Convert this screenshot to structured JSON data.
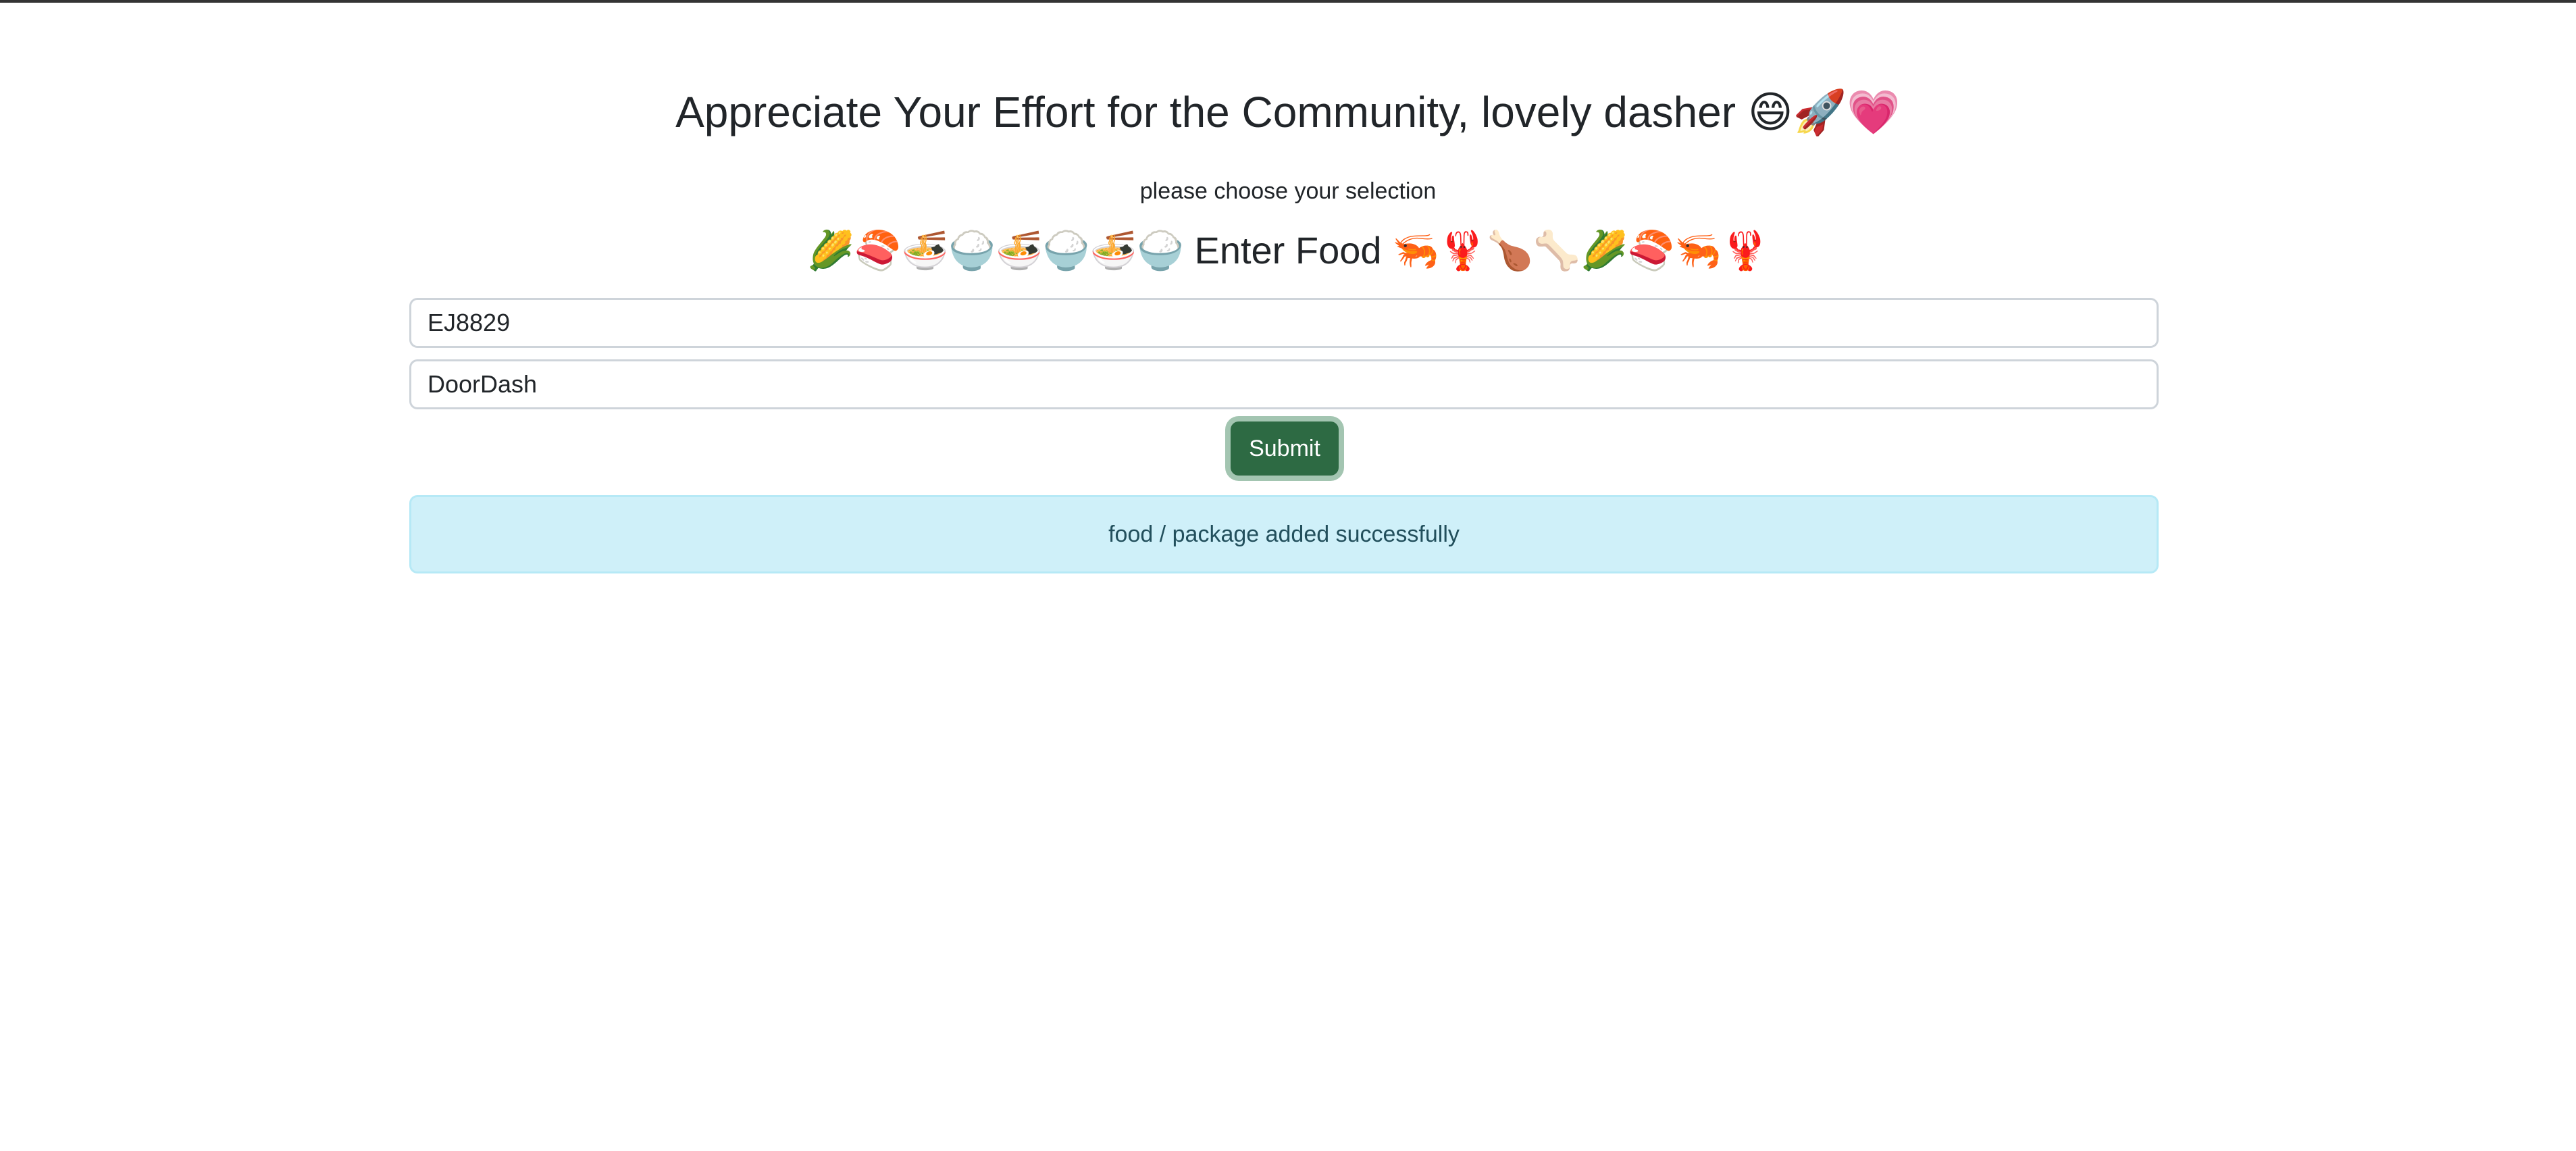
{
  "header": {
    "title": "Appreciate Your Effort for the Community, lovely dasher 😄🚀💗",
    "subtitle": "please choose your selection",
    "food_heading": "🌽🍣🍜🍚🍜🍚🍜🍚 Enter Food 🦐🦞🍗🦴🌽🍣🦐🦞"
  },
  "form": {
    "code_value": "EJ8829",
    "service_value": "DoorDash",
    "submit_label": "Submit"
  },
  "alert": {
    "message": "food / package added successfully"
  },
  "colors": {
    "button": "#2d6a43",
    "alert_bg": "#cff0f9"
  }
}
